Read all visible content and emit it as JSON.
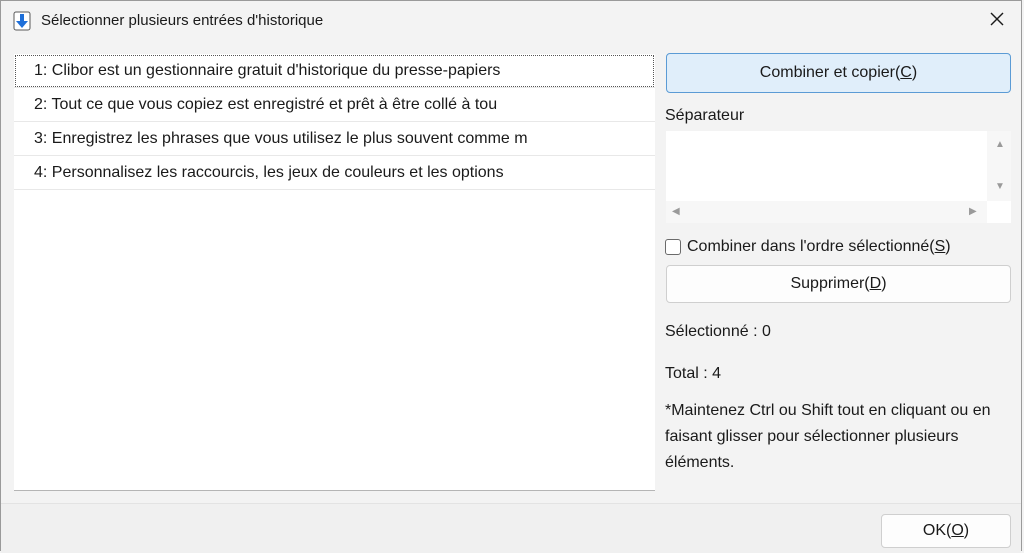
{
  "window": {
    "title": "Sélectionner plusieurs entrées d'historique"
  },
  "history": {
    "items": [
      "1: Clibor est un gestionnaire gratuit d'historique du presse-papiers",
      "2: Tout ce que vous copiez est enregistré et prêt à être collé à tou",
      "3: Enregistrez les phrases que vous utilisez le plus souvent comme m",
      "4: Personnalisez les raccourcis, les jeux de couleurs et les options"
    ]
  },
  "actions": {
    "combine_copy_label": "Combiner et copier(",
    "combine_copy_key": "C",
    "separator_label": "Séparateur",
    "separator_value": "",
    "order_checkbox_label": "Combiner dans l'ordre sélectionné(",
    "order_checkbox_key": "S",
    "order_checked": false,
    "delete_label": "Supprimer(",
    "delete_key": "D"
  },
  "status": {
    "selected": "Sélectionné : 0",
    "total": "Total : 4",
    "hint": "*Maintenez Ctrl ou Shift tout en cliquant ou en faisant glisser pour sélectionner plusieurs éléments."
  },
  "footer": {
    "ok_label": "OK(",
    "ok_key": "O"
  },
  "icons": {
    "app": "download-arrow-icon",
    "close": "close-icon"
  },
  "colors": {
    "primary_button_bg": "#e0eefa",
    "primary_button_border": "#5b9bd5",
    "app_icon_blue": "#1e6fd9"
  }
}
